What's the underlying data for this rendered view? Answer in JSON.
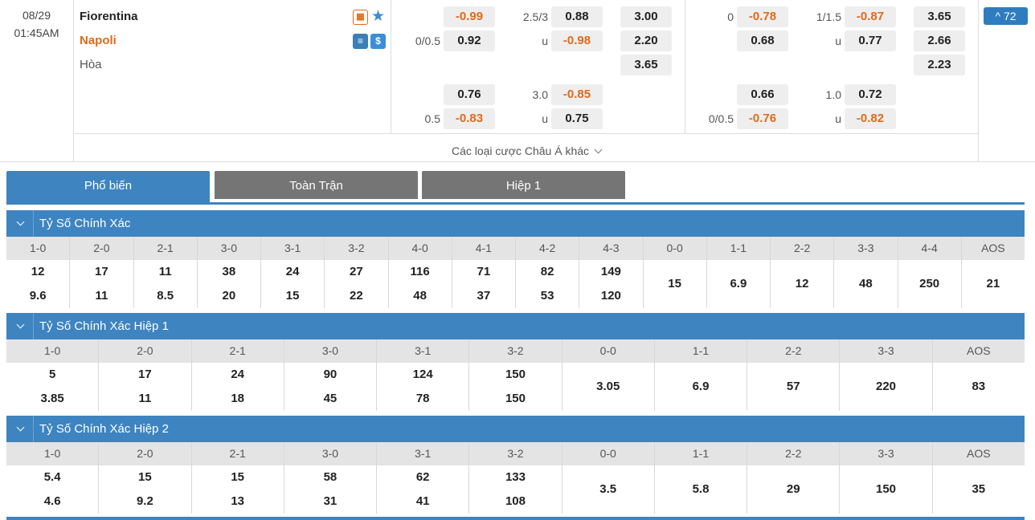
{
  "match": {
    "date": "08/29",
    "time": "01:45AM",
    "home_team": "Fiorentina",
    "away_team": "Napoli",
    "draw_label": "Hòa",
    "home_icon": "stats-icon",
    "away_icons": [
      "lineup-icon",
      "money-icon"
    ],
    "favorite_icon": "star-icon",
    "more_markets_count": "^ 72",
    "more_bets_label": "Các loại cược Châu Á khác"
  },
  "full_time": {
    "handicap": {
      "home_line": "",
      "home_odds": "-0.99",
      "away_line": "0/0.5",
      "away_odds": "0.92"
    },
    "over_under": {
      "line": "2.5/3",
      "over_odds": "0.88",
      "under_label": "u",
      "under_odds": "-0.98"
    },
    "one_x_two": {
      "home": "3.00",
      "away": "2.20",
      "draw": "3.65"
    },
    "alt_handicap": {
      "home_line": "",
      "home_odds": "0.76",
      "away_line": "0.5",
      "away_odds": "-0.83"
    },
    "alt_over_under": {
      "line": "3.0",
      "over_odds": "-0.85",
      "under_label": "u",
      "under_odds": "0.75"
    }
  },
  "first_half": {
    "handicap": {
      "home_line": "0",
      "home_odds": "-0.78",
      "away_line": "",
      "away_odds": "0.68"
    },
    "over_under": {
      "line": "1/1.5",
      "over_odds": "-0.87",
      "under_label": "u",
      "under_odds": "0.77"
    },
    "one_x_two": {
      "home": "3.65",
      "away": "2.66",
      "draw": "2.23"
    },
    "alt_handicap": {
      "home_line": "",
      "home_odds": "0.66",
      "away_line": "0/0.5",
      "away_odds": "-0.76"
    },
    "alt_over_under": {
      "line": "1.0",
      "over_odds": "0.72",
      "under_label": "u",
      "under_odds": "-0.82"
    }
  },
  "tabs": [
    "Phổ biến",
    "Toàn Trận",
    "Hiệp 1"
  ],
  "sections": [
    {
      "title": "Tỷ Số Chính Xác",
      "columns": [
        {
          "score": "1-0",
          "home": "12",
          "away": "9.6"
        },
        {
          "score": "2-0",
          "home": "17",
          "away": "11"
        },
        {
          "score": "2-1",
          "home": "11",
          "away": "8.5"
        },
        {
          "score": "3-0",
          "home": "38",
          "away": "20"
        },
        {
          "score": "3-1",
          "home": "24",
          "away": "15"
        },
        {
          "score": "3-2",
          "home": "27",
          "away": "22"
        },
        {
          "score": "4-0",
          "home": "116",
          "away": "48"
        },
        {
          "score": "4-1",
          "home": "71",
          "away": "37"
        },
        {
          "score": "4-2",
          "home": "82",
          "away": "53"
        },
        {
          "score": "4-3",
          "home": "149",
          "away": "120"
        },
        {
          "score": "0-0",
          "single": "15"
        },
        {
          "score": "1-1",
          "single": "6.9"
        },
        {
          "score": "2-2",
          "single": "12"
        },
        {
          "score": "3-3",
          "single": "48"
        },
        {
          "score": "4-4",
          "single": "250"
        },
        {
          "score": "AOS",
          "single": "21"
        }
      ]
    },
    {
      "title": "Tỷ Số Chính Xác Hiệp 1",
      "columns": [
        {
          "score": "1-0",
          "home": "5",
          "away": "3.85"
        },
        {
          "score": "2-0",
          "home": "17",
          "away": "11"
        },
        {
          "score": "2-1",
          "home": "24",
          "away": "18"
        },
        {
          "score": "3-0",
          "home": "90",
          "away": "45"
        },
        {
          "score": "3-1",
          "home": "124",
          "away": "78"
        },
        {
          "score": "3-2",
          "home": "150",
          "away": "150"
        },
        {
          "score": "0-0",
          "single": "3.05"
        },
        {
          "score": "1-1",
          "single": "6.9"
        },
        {
          "score": "2-2",
          "single": "57"
        },
        {
          "score": "3-3",
          "single": "220"
        },
        {
          "score": "AOS",
          "single": "83"
        }
      ]
    },
    {
      "title": "Tỷ Số Chính Xác Hiệp 2",
      "columns": [
        {
          "score": "1-0",
          "home": "5.4",
          "away": "4.6"
        },
        {
          "score": "2-0",
          "home": "15",
          "away": "9.2"
        },
        {
          "score": "2-1",
          "home": "15",
          "away": "13"
        },
        {
          "score": "3-0",
          "home": "58",
          "away": "31"
        },
        {
          "score": "3-1",
          "home": "62",
          "away": "41"
        },
        {
          "score": "3-2",
          "home": "133",
          "away": "108"
        },
        {
          "score": "0-0",
          "single": "3.5"
        },
        {
          "score": "1-1",
          "single": "5.8"
        },
        {
          "score": "2-2",
          "single": "29"
        },
        {
          "score": "3-3",
          "single": "150"
        },
        {
          "score": "AOS",
          "single": "35"
        }
      ]
    }
  ],
  "colors": {
    "accent_blue": "#3d84c1",
    "negative_orange": "#e06a1a",
    "tab_gray": "#757575"
  }
}
